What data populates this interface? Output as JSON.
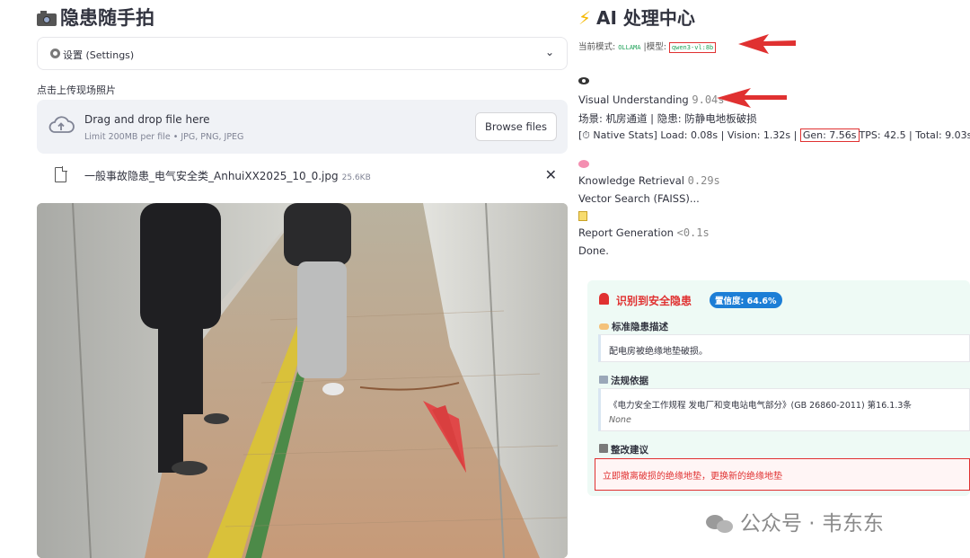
{
  "app": {
    "title": "隐患随手拍"
  },
  "settings_expander": {
    "label": "设置 (Settings)"
  },
  "uploader": {
    "label": "点击上传现场照片",
    "drop_title": "Drag and drop file here",
    "drop_sub": "Limit 200MB per file • JPG, PNG, JPEG",
    "browse_label": "Browse files",
    "file_name": "一般事故隐患_电气安全类_AnhuiXX2025_10_0.jpg",
    "file_size": "25.6KB"
  },
  "ai_panel": {
    "title": "AI 处理中心",
    "mode_prefix": "当前模式:",
    "mode_value": "OLLAMA",
    "model_prefix": "|模型:",
    "model_value": "qwen3-vl:8b",
    "visual_label": "Visual Understanding",
    "visual_time": "9.04s",
    "scene_line": "场景: 机房通道 | 隐患: 防静电地板破损",
    "stats_prefix": "[⏱ Native Stats] Load: 0.08s | Vision: 1.32s |",
    "stats_gen": "Gen: 7.56s",
    "stats_suffix": "TPS: 42.5 | Total: 9.03s",
    "knowledge_label": "Knowledge Retrieval",
    "knowledge_time": "0.29s",
    "vector_line": "Vector Search (FAISS)...",
    "report_label": "Report Generation",
    "report_time": "<0.1s",
    "done_line": "Done."
  },
  "result_card": {
    "alert_title": "识别到安全隐患",
    "confidence": "置信度: 64.6%",
    "desc_heading": "标准隐患描述",
    "desc_text": "配电房被绝缘地垫破损。",
    "law_heading": "法规依据",
    "law_text": "《电力安全工作规程 发电厂和变电站电气部分》(GB 26860-2011) 第16.1.3条",
    "law_note": "None",
    "fix_heading": "整改建议",
    "fix_text": "立即撤离破损的绝缘地垫，更换新的绝缘地垫"
  },
  "watermark": {
    "text": "公众号 · 韦东东"
  },
  "colors": {
    "accent_red": "#e03131",
    "badge_blue": "#1c7ed6",
    "card_bg": "#eefaf5"
  }
}
